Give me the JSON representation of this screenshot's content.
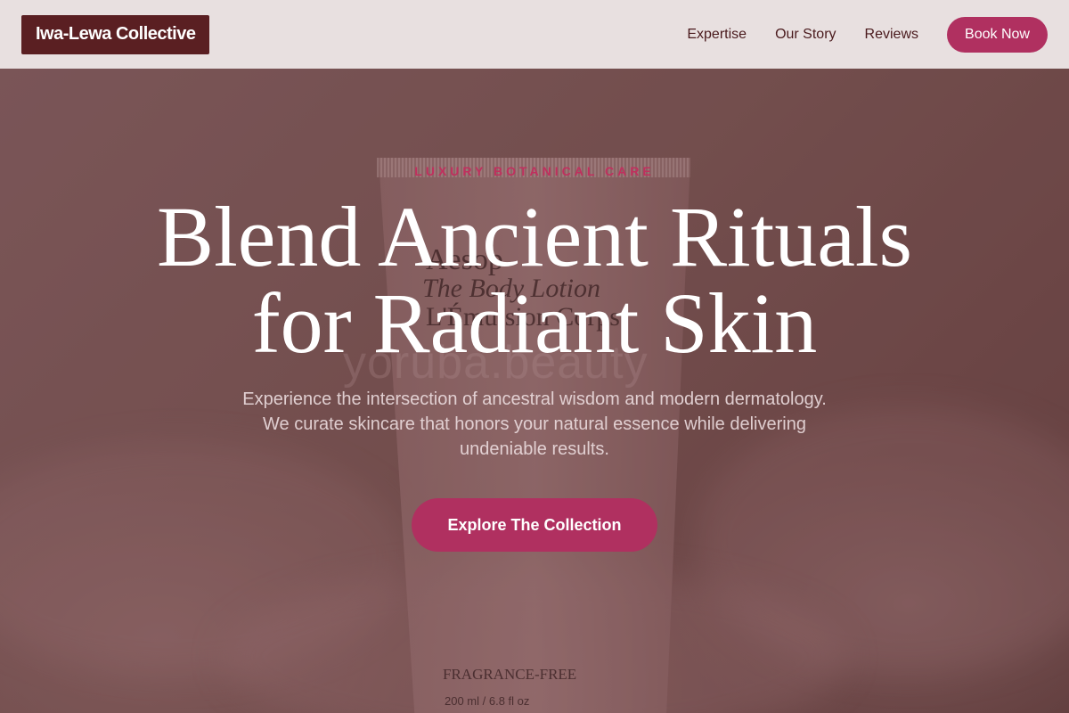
{
  "header": {
    "logo": "Iwa-Lewa Collective",
    "nav": [
      "Expertise",
      "Our Story",
      "Reviews"
    ],
    "book_label": "Book Now"
  },
  "hero": {
    "eyebrow": "LUXURY BOTANICAL CARE",
    "headline_line1": "Blend Ancient Rituals",
    "headline_line2": "for Radiant Skin",
    "subtext": "Experience the intersection of ancestral wisdom and modern dermatology. We curate skincare that honors your natural essence while delivering undeniable results.",
    "cta_label": "Explore The Collection"
  },
  "product": {
    "brand": "Aesop",
    "name": "The Body Lotion",
    "sub": "L'Émulsion Corps",
    "watermark": "yoruba.beauty",
    "fragrance": "FRAGRANCE-FREE",
    "volume": "200 ml / 6.8 fl oz"
  },
  "colors": {
    "accent": "#b03060",
    "logo_bg": "#5a1f22",
    "header_bg": "#e8e0e0",
    "nav_text": "#4a1a1d"
  }
}
